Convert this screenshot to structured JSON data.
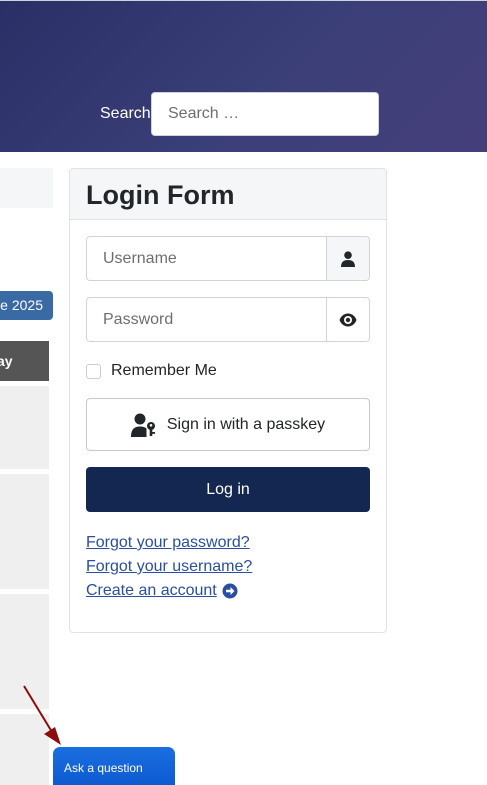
{
  "header": {
    "search_label": "Search",
    "search_placeholder": "Search …"
  },
  "left_column": {
    "date_badge": "e 2025",
    "day_label": "ay"
  },
  "login": {
    "title": "Login Form",
    "username_placeholder": "Username",
    "password_placeholder": "Password",
    "remember_label": "Remember Me",
    "passkey_label": "Sign in with a passkey",
    "login_label": "Log in",
    "links": {
      "forgot_password": "Forgot your password?",
      "forgot_username": "Forgot your username?",
      "create_account": "Create an account"
    }
  },
  "help": {
    "ask_label": "Ask a question"
  },
  "colors": {
    "header_bg": "#3b3f78",
    "login_button": "#132750",
    "link": "#2a4ea0",
    "ask_tab": "#1266dd",
    "arrow": "#8b0d0d"
  },
  "icons": [
    "user-icon",
    "eye-icon",
    "passkey-user-icon",
    "arrow-right-circle-icon",
    "pointer-arrow-icon"
  ]
}
